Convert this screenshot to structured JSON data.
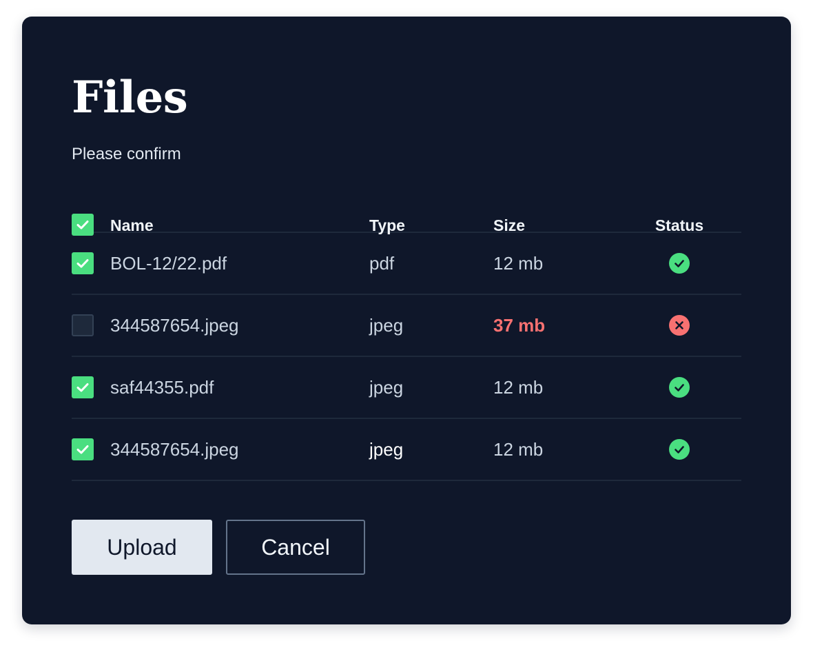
{
  "dialog": {
    "title": "Files",
    "subtitle": "Please confirm"
  },
  "table": {
    "columns": [
      "Name",
      "Type",
      "Size",
      "Status"
    ],
    "select_all_checked": true,
    "rows": [
      {
        "checked": true,
        "name": "BOL-12/22.pdf",
        "type": "pdf",
        "size": "12 mb",
        "status": "ok"
      },
      {
        "checked": false,
        "name": "344587654.jpeg",
        "type": "jpeg",
        "size": "37 mb",
        "status": "error"
      },
      {
        "checked": true,
        "name": "saf44355.pdf",
        "type": "jpeg",
        "size": "12 mb",
        "status": "ok"
      },
      {
        "checked": true,
        "name": "344587654.jpeg",
        "type": "jpeg",
        "size": "12 mb",
        "status": "ok"
      }
    ]
  },
  "buttons": {
    "upload_label": "Upload",
    "cancel_label": "Cancel"
  },
  "icons": {
    "check": "check-icon",
    "success": "check-circle-icon",
    "error": "x-circle-icon"
  },
  "colors": {
    "background": "#0f172a",
    "success": "#4ade80",
    "error": "#f87171"
  }
}
